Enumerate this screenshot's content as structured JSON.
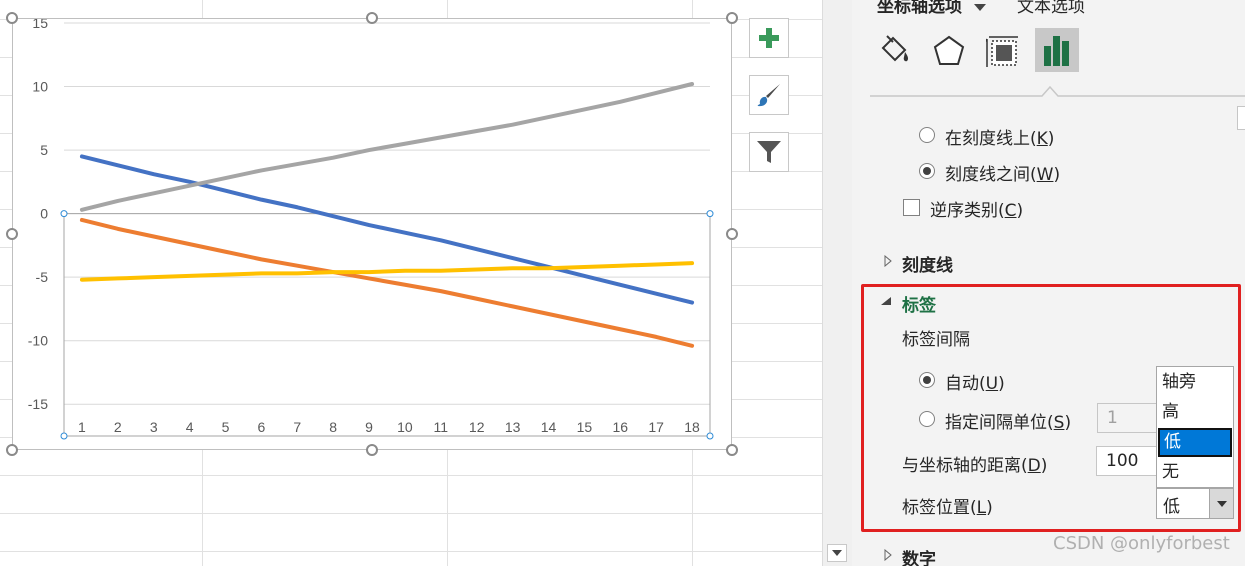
{
  "chart": {
    "chart_data": {
      "type": "line",
      "x": [
        1,
        2,
        3,
        4,
        5,
        6,
        7,
        8,
        9,
        10,
        11,
        12,
        13,
        14,
        15,
        16,
        17,
        18
      ],
      "ylim": [
        -17.5,
        15
      ],
      "yticks": [
        15,
        10,
        5,
        0,
        -5,
        -10,
        -15
      ],
      "grid": true,
      "series": [
        {
          "color": "#4472c4",
          "values": [
            4.5,
            3.8,
            3.1,
            2.5,
            1.8,
            1.1,
            0.5,
            -0.2,
            -0.9,
            -1.5,
            -2.1,
            -2.8,
            -3.5,
            -4.2,
            -4.9,
            -5.6,
            -6.3,
            -7.0
          ]
        },
        {
          "color": "#ed7d31",
          "values": [
            -0.5,
            -1.2,
            -1.8,
            -2.4,
            -3.0,
            -3.6,
            -4.1,
            -4.6,
            -5.1,
            -5.6,
            -6.1,
            -6.7,
            -7.3,
            -7.9,
            -8.5,
            -9.1,
            -9.7,
            -10.4
          ]
        },
        {
          "color": "#a5a5a5",
          "values": [
            0.3,
            1.0,
            1.6,
            2.2,
            2.8,
            3.4,
            3.9,
            4.4,
            5.0,
            5.5,
            6.0,
            6.5,
            7.0,
            7.6,
            8.2,
            8.8,
            9.5,
            10.2
          ]
        },
        {
          "color": "#ffc000",
          "values": [
            -5.2,
            -5.1,
            -5.0,
            -4.9,
            -4.8,
            -4.7,
            -4.7,
            -4.6,
            -4.6,
            -4.5,
            -4.5,
            -4.4,
            -4.3,
            -4.3,
            -4.2,
            -4.1,
            -4.0,
            -3.9
          ]
        }
      ]
    }
  },
  "chart_tools": {
    "add": "plus-icon",
    "style": "brush-icon",
    "filter": "funnel-icon"
  },
  "pane": {
    "tab_axis_options": "坐标轴选项",
    "tab_text_options": "文本选项",
    "radio_on_tick": "在刻度线上(",
    "radio_on_tick_key": "K",
    "radio_between_tick": "刻度线之间(",
    "radio_between_tick_key": "W",
    "checkbox_reverse": "逆序类别(",
    "checkbox_reverse_key": "C",
    "section_tick_marks": "刻度线",
    "section_labels": "标签",
    "label_interval": "标签间隔",
    "radio_auto": "自动(",
    "radio_auto_key": "U",
    "radio_interval_unit": "指定间隔单位(",
    "radio_interval_unit_key": "S",
    "interval_value": "1",
    "distance_label": "与坐标轴的距离(",
    "distance_key": "D",
    "distance_value": "100",
    "label_position": "标签位置(",
    "label_position_key": "L",
    "label_position_value": "低",
    "dropdown_options": [
      "轴旁",
      "高",
      "低",
      "无"
    ],
    "section_number": "数字",
    "close_paren": ")"
  },
  "watermark": "CSDN @onlyforbest"
}
